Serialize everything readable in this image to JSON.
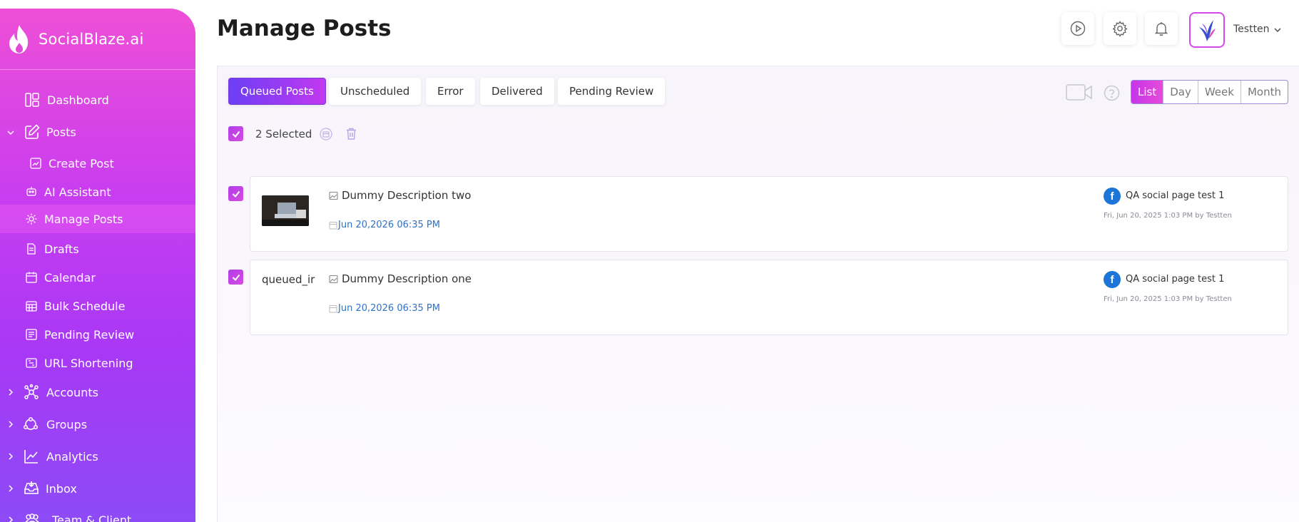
{
  "brand": {
    "name": "SocialBlaze.ai"
  },
  "sidebar": {
    "items": [
      {
        "label": "Dashboard",
        "icon": "dashboard-icon"
      },
      {
        "label": "Posts",
        "icon": "edit-icon",
        "expanded": true
      },
      {
        "label": "Create Post",
        "icon": "create-post-icon"
      },
      {
        "label": "AI Assistant",
        "icon": "robot-icon"
      },
      {
        "label": "Manage Posts",
        "icon": "gear-icon",
        "active": true
      },
      {
        "label": "Drafts",
        "icon": "drafts-icon"
      },
      {
        "label": "Calendar",
        "icon": "calendar-icon"
      },
      {
        "label": "Bulk Schedule",
        "icon": "calendar-grid-icon"
      },
      {
        "label": "Pending Review",
        "icon": "review-icon"
      },
      {
        "label": "URL Shortening",
        "icon": "link-icon"
      },
      {
        "label": "Accounts",
        "icon": "network-icon"
      },
      {
        "label": "Groups",
        "icon": "groups-icon"
      },
      {
        "label": "Analytics",
        "icon": "chart-icon"
      },
      {
        "label": "Inbox",
        "icon": "inbox-icon"
      },
      {
        "label": "Team & Client",
        "icon": "team-icon"
      }
    ]
  },
  "header": {
    "title": "Manage Posts",
    "user_name": "Testten"
  },
  "tabs": [
    {
      "label": "Queued Posts",
      "active": true
    },
    {
      "label": "Unscheduled"
    },
    {
      "label": "Error"
    },
    {
      "label": "Delivered"
    },
    {
      "label": "Pending Review"
    }
  ],
  "view_modes": [
    "List",
    "Day",
    "Week",
    "Month"
  ],
  "active_view": "List",
  "selection": {
    "text": "2 Selected"
  },
  "posts": [
    {
      "thumbnail": "image",
      "description": "Dummy Description two",
      "scheduled": "Jun 20,2026 06:35 PM",
      "page": "QA social page test 1",
      "meta": "Fri, Jun 20, 2025 1:03 PM by Testten"
    },
    {
      "thumbnail_alt": "queued_ir",
      "description": "Dummy Description one",
      "scheduled": "Jun 20,2026 06:35 PM",
      "page": "QA social page test 1",
      "meta": "Fri, Jun 20, 2025 1:03 PM by Testten"
    }
  ],
  "colors": {
    "accent": "#c635ea",
    "accent_blue": "#6b3ff5",
    "link": "#2e72c9",
    "facebook": "#1d75d8"
  }
}
